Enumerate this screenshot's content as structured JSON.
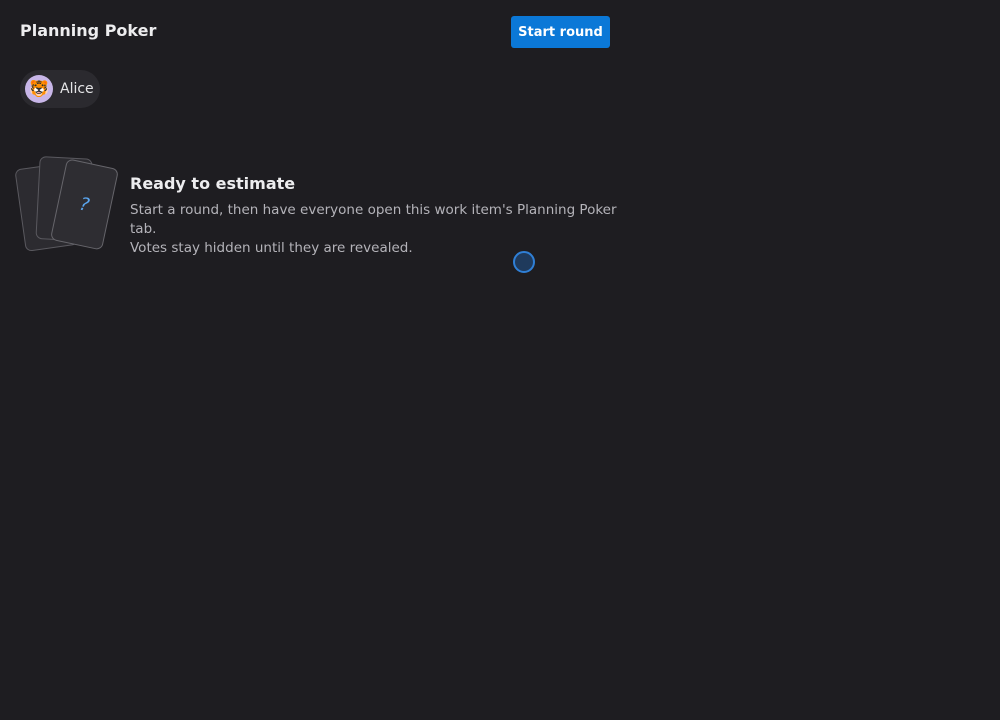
{
  "header": {
    "title": "Planning Poker",
    "start_round_label": "Start round"
  },
  "participants": [
    {
      "name": "Alice",
      "avatar_emoji": "🐯"
    }
  ],
  "empty_state": {
    "title": "Ready to estimate",
    "line1": "Start a round, then have everyone open this work item's Planning Poker tab.",
    "line2": "Votes stay hidden until they are revealed.",
    "card_symbol": "?"
  },
  "colors": {
    "background": "#1e1d21",
    "accent": "#0b78d7",
    "card_symbol": "#5aa6f0"
  },
  "icons": {
    "cards": "card-stack-icon",
    "loading": "spinner-icon"
  }
}
